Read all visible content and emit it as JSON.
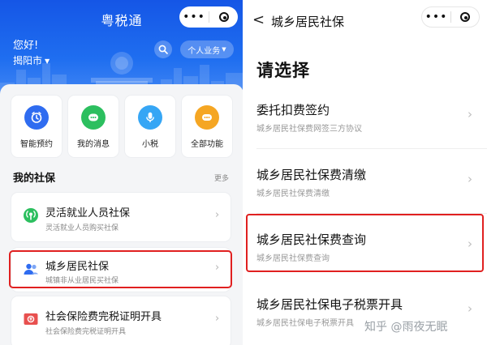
{
  "left": {
    "app_title": "粤税通",
    "greeting": "您好!",
    "city": "揭阳市",
    "biz_button": "个人业务",
    "quick_actions": [
      {
        "label": "智能预约",
        "icon": "clock-icon",
        "color": "#2f6cf0"
      },
      {
        "label": "我的消息",
        "icon": "message-icon",
        "color": "#2cbf5f"
      },
      {
        "label": "小税",
        "icon": "microphone-icon",
        "color": "#36a6f5"
      },
      {
        "label": "全部功能",
        "icon": "more-dots-icon",
        "color": "#f5a623"
      }
    ],
    "section_title": "我的社保",
    "more_label": "更多",
    "cards": [
      {
        "title": "灵活就业人员社保",
        "subtitle": "灵活就业人员购买社保",
        "icon": "signal-icon",
        "color": "#2cbf5f"
      },
      {
        "title": "城乡居民社保",
        "subtitle": "城镇非从业居民买社保",
        "icon": "people-icon",
        "color": "#2f6cf0"
      },
      {
        "title": "社会保险费完税证明开具",
        "subtitle": "社会保险费完税证明开具",
        "icon": "certificate-icon",
        "color": "#e8504f"
      }
    ]
  },
  "right": {
    "back_symbol": "<",
    "title": "城乡居民社保",
    "heading": "请选择",
    "options": [
      {
        "title": "委托扣费签约",
        "subtitle": "城乡居民社保费网签三方协议"
      },
      {
        "title": "城乡居民社保费清缴",
        "subtitle": "城乡居民社保费清缴"
      },
      {
        "title": "城乡居民社保费查询",
        "subtitle": "城乡居民社保费查询"
      },
      {
        "title": "城乡居民社保电子税票开具",
        "subtitle": "城乡居民社保电子税票开具"
      }
    ]
  },
  "capsule": {
    "dots": "•••"
  },
  "watermark": "知乎 @雨夜无眠",
  "colors": {
    "brand_blue": "#1f6ef0",
    "highlight_red": "#e02020"
  }
}
